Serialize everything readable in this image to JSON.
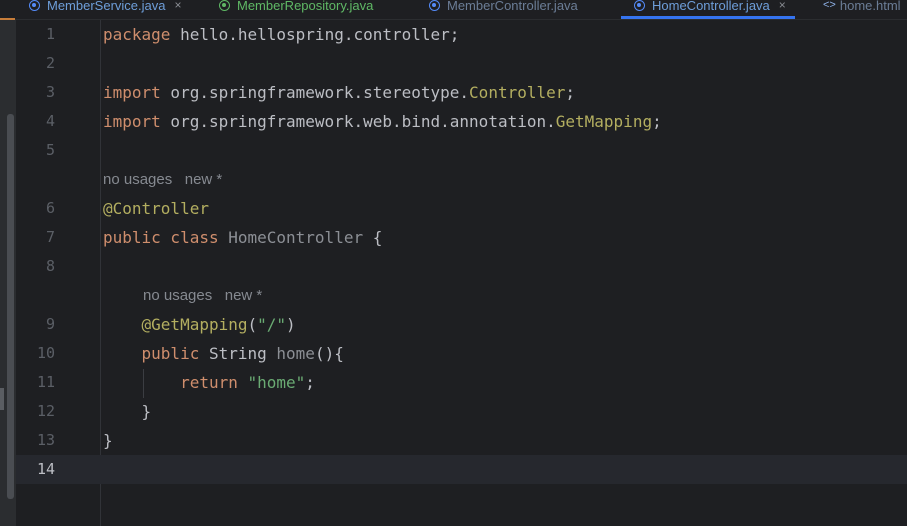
{
  "tabs": [
    {
      "name": "MemberService.java",
      "close": "×",
      "color": "blue",
      "icon": "class-icon"
    },
    {
      "name": "MemberRepository.java",
      "close": "",
      "color": "green",
      "icon": "interface-icon"
    },
    {
      "name": "MemberController.java",
      "close": "",
      "color": "dim",
      "icon": "class-icon"
    },
    {
      "name": "HomeController.java",
      "close": "×",
      "color": "blue",
      "icon": "class-icon",
      "active": true
    },
    {
      "name": "home.html",
      "close": "",
      "color": "dim",
      "icon": "html-icon",
      "glyph": "<>"
    }
  ],
  "editor": {
    "current_line": "14",
    "line_numbers": [
      "1",
      "2",
      "3",
      "4",
      "5",
      "6",
      "7",
      "8",
      "9",
      "10",
      "11",
      "12",
      "13",
      "14"
    ],
    "hints": {
      "class_usages": "no usages",
      "class_new": "new *",
      "method_usages": "no usages",
      "method_new": "new *"
    },
    "code": {
      "l1_kw": "package",
      "l1_rest": " hello.hellospring.controller;",
      "l3_kw": "import",
      "l3_pkg": " org.springframework.stereotype.",
      "l3_cls": "Controller",
      "l3_end": ";",
      "l4_kw": "import",
      "l4_pkg": " org.springframework.web.bind.annotation.",
      "l4_cls": "GetMapping",
      "l4_end": ";",
      "l6_ann": "@Controller",
      "l7_kw": "public class",
      "l7_cls": " HomeController",
      "l7_end": " {",
      "l9_ann": "@GetMapping",
      "l9_open": "(",
      "l9_str": "\"/\"",
      "l9_close": ")",
      "l10_kw": "public",
      "l10_type": " String",
      "l10_fn": " home",
      "l10_end": "(){",
      "l11_kw": "return",
      "l11_str": " \"home\"",
      "l11_end": ";",
      "l12": "}",
      "l13": "}"
    }
  }
}
